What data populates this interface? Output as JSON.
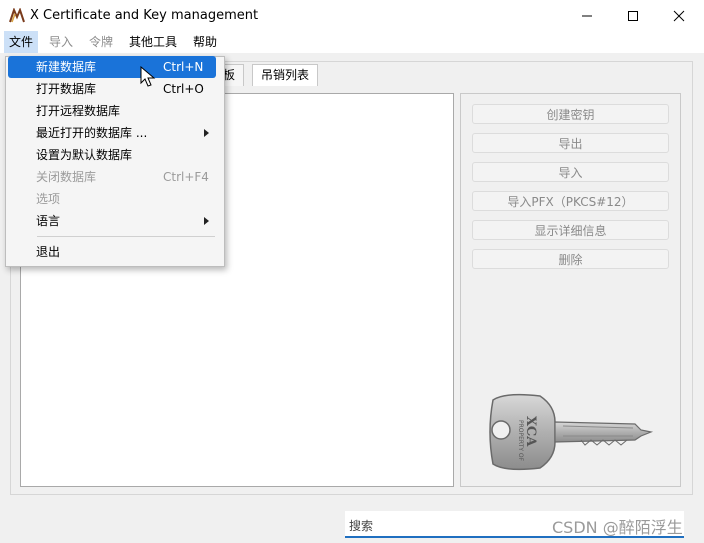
{
  "window": {
    "title": "X Certificate and Key management",
    "icons": [
      "minimize-icon",
      "maximize-icon",
      "close-icon"
    ]
  },
  "menubar": {
    "file": "文件",
    "import": "导入",
    "token": "令牌",
    "tools": "其他工具",
    "help": "帮助"
  },
  "tabs": {
    "templates_partial": "板",
    "crl": "吊销列表"
  },
  "side_buttons": [
    "创建密钥",
    "导出",
    "导入",
    "导入PFX（PKCS#12）",
    "显示详细信息",
    "删除"
  ],
  "file_menu": {
    "items": [
      {
        "label": "新建数据库",
        "shortcut": "Ctrl+N"
      },
      {
        "label": "打开数据库",
        "shortcut": "Ctrl+O"
      },
      {
        "label": "打开远程数据库",
        "shortcut": ""
      },
      {
        "label": "最近打开的数据库 ...",
        "shortcut": ""
      },
      {
        "label": "设置为默认数据库",
        "shortcut": ""
      },
      {
        "label": "关闭数据库",
        "shortcut": "Ctrl+F4"
      },
      {
        "label": "选项",
        "shortcut": ""
      },
      {
        "label": "语言",
        "shortcut": ""
      },
      {
        "label": "退出",
        "shortcut": ""
      }
    ]
  },
  "search": {
    "label": "搜索"
  },
  "watermark": "CSDN @醉陌浮生",
  "key_art": {
    "engraving_small": "PROPERTY OF",
    "engraving_large": "XCA"
  },
  "colors": {
    "highlight": "#1a73d9",
    "search_underline": "#1f6fc0",
    "menu_active": "#cce0f7"
  }
}
